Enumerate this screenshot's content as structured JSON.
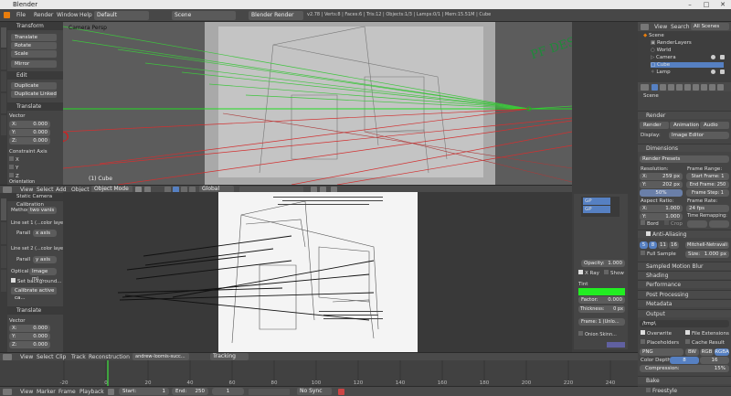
{
  "window": {
    "title": "Blender"
  },
  "menubar": {
    "items": [
      "File",
      "Render",
      "Window",
      "Help"
    ],
    "layout_name": "Default",
    "scene_name": "Scene",
    "engine": "Blender Render",
    "stats": "v2.78 | Verts:8 | Faces:6 | Tris:12 | Objects:1/3 | Lamps:0/1 | Mem:15.51M | Cube"
  },
  "left_toolshelf": {
    "transform_header": "Transform",
    "transform_buttons": [
      "Translate",
      "Rotate",
      "Scale",
      "Mirror"
    ],
    "edit_header": "Edit",
    "edit_buttons": [
      "Duplicate",
      "Duplicate Linked"
    ],
    "translate_header": "Translate",
    "vector_label": "Vector",
    "vector": [
      {
        "axis": "X:",
        "value": "0.000"
      },
      {
        "axis": "Y:",
        "value": "0.000"
      },
      {
        "axis": "Z:",
        "value": "0.000"
      }
    ],
    "constraint_label": "Constraint Axis",
    "constraint_axes": [
      "X",
      "Y",
      "Z"
    ],
    "orientation_label": "Orientation",
    "vtabs": [
      "Tools",
      "Create",
      "Relations",
      "Animation",
      "Physics",
      "Grease Pencil"
    ]
  },
  "viewport": {
    "label": "Camera Persp",
    "object_label": "(1) Cube",
    "handwriting_pf": "PF DESSIN",
    "handwriting_3d": "PF 3D",
    "header": {
      "menus": [
        "View",
        "Select",
        "Add",
        "Object"
      ],
      "mode": "Object Mode",
      "orientation": "Global"
    }
  },
  "clip_toolshelf": {
    "header": "Static Camera Calibration",
    "method_label": "Method:",
    "method": "two vanis",
    "line_set1": "Line set 1 (...color layer)",
    "parallel1_label": "Parall",
    "parallel1": "x axis",
    "line_set2": "Line set 2 (...color layer)",
    "parallel2_label": "Parall",
    "parallel2": "y axis",
    "optical_label": "Optical",
    "optical": "Image mi...",
    "set_background": "Set background...",
    "calibrate_button": "Calibrate active ca...",
    "translate_header": "Translate",
    "vector_label": "Vector",
    "vector": [
      {
        "axis": "X:",
        "value": "0.000"
      },
      {
        "axis": "Y:",
        "value": "0.000"
      },
      {
        "axis": "Z:",
        "value": "0.000"
      }
    ],
    "vtabs": [
      "Tools",
      "Grease Pencil",
      "Solve",
      "Track"
    ]
  },
  "grease_pencil_panel": {
    "layers": [
      "GP",
      "GP"
    ],
    "opacity_label": "Opacity:",
    "opacity": "1.000",
    "xray": "X Ray",
    "show": "Show",
    "tint_label": "Tint",
    "tint_color": "#22ee22",
    "factor_label": "Factor:",
    "factor": "0.000",
    "thickness_label": "Thickness:",
    "thickness": "0 px",
    "frame_label": "Frame: 1 (Unlo...",
    "onion_label": "Onion Skinn..."
  },
  "clip_header": {
    "menus": [
      "View",
      "Select",
      "Clip",
      "Track",
      "Reconstruction"
    ],
    "clip_name": "andrew-loomis-succ...",
    "tracking": "Tracking"
  },
  "timeline": {
    "menus": [
      "View",
      "Marker",
      "Frame",
      "Playback"
    ],
    "start_label": "Start:",
    "start": "1",
    "end_label": "End:",
    "end": "250",
    "current": "1",
    "sync": "No Sync",
    "ticks": [
      "-20",
      "0",
      "20",
      "40",
      "60",
      "80",
      "100",
      "120",
      "140",
      "160",
      "180",
      "200",
      "220",
      "240",
      "260"
    ]
  },
  "outliner": {
    "menus": [
      "View",
      "Search",
      "All Scenes"
    ],
    "items": [
      "Scene",
      "RenderLayers",
      "World",
      "Camera",
      "Cube",
      "Lamp"
    ]
  },
  "properties": {
    "scene_path": "Scene",
    "render_header": "Render",
    "render_buttons": [
      "Render",
      "Animation",
      "Audio"
    ],
    "display_label": "Display:",
    "display": "Image Editor",
    "dimensions_header": "Dimensions",
    "render_presets": "Render Presets",
    "resolution_label": "Resolution:",
    "res_x": "259 px",
    "res_y": "202 px",
    "res_pct": "50%",
    "frame_range_label": "Frame Range:",
    "start_frame": "Start Frame: 1",
    "end_frame": "End Frame: 250",
    "frame_step": "Frame Step: 1",
    "aspect_label": "Aspect Ratio:",
    "aspect_x": "1.000",
    "aspect_y": "1.000",
    "frame_rate_label": "Frame Rate:",
    "frame_rate": "24 fps",
    "time_remap_label": "Time Remapping:",
    "border": "Bord",
    "crop": "Crop",
    "aa_header": "Anti-Aliasing",
    "aa_samples": [
      "5",
      "8",
      "11",
      "16"
    ],
    "aa_filter": "Mitchell-Netravali",
    "full_sample": "Full Sample",
    "size_label": "Size:",
    "size": "1.000 px",
    "sampled_motion_blur": "Sampled Motion Blur",
    "shading": "Shading",
    "performance": "Performance",
    "post_processing": "Post Processing",
    "metadata": "Metadata",
    "output_header": "Output",
    "output_path": "/tmp\\",
    "overwrite": "Overwrite",
    "file_extensions": "File Extensions",
    "placeholders": "Placeholders",
    "cache_result": "Cache Result",
    "format": "PNG",
    "color_modes": [
      "BW",
      "RGB",
      "RGBA"
    ],
    "color_depth_label": "Color Depth:",
    "color_depths": [
      "8",
      "16"
    ],
    "compression_label": "Compression:",
    "compression": "15%",
    "bake": "Bake",
    "freestyle": "Freestyle",
    "accent": "#5680c2"
  }
}
